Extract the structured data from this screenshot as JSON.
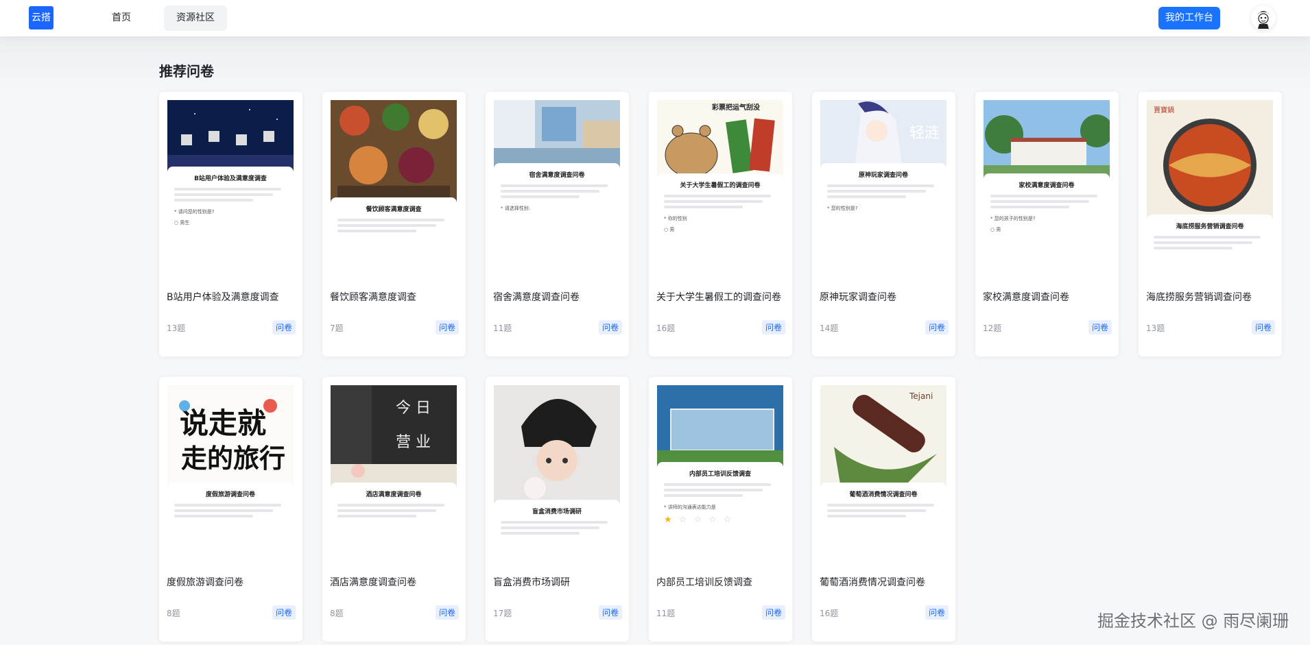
{
  "header": {
    "logo_text": "云搭",
    "nav": [
      {
        "label": "首页"
      },
      {
        "label": "资源社区"
      }
    ],
    "workbench_label": "我的工作台"
  },
  "section": {
    "title": "推荐问卷"
  },
  "cards": [
    {
      "title": "B站用户体验及满意度调查",
      "count": "13题",
      "tag": "问卷",
      "sheet_title": "B站用户体验及满意度调查",
      "question": "* 请问您的性别是?",
      "option": "男生"
    },
    {
      "title": "餐饮顾客满意度调查",
      "count": "7题",
      "tag": "问卷",
      "sheet_title": "餐饮顾客满意度调查",
      "question": "",
      "option": ""
    },
    {
      "title": "宿舍满意度调查问卷",
      "count": "11题",
      "tag": "问卷",
      "sheet_title": "宿舍满意度调查问卷",
      "question": "* 请选择性别:",
      "option": ""
    },
    {
      "title": "关于大学生暑假工的调查问卷",
      "count": "16题",
      "tag": "问卷",
      "sheet_title": "关于大学生暑假工的调查问卷",
      "question": "* 你的性别",
      "option": "男"
    },
    {
      "title": "原神玩家调查问卷",
      "count": "14题",
      "tag": "问卷",
      "sheet_title": "原神玩家调查问卷",
      "question": "* 您的性别是?",
      "option": ""
    },
    {
      "title": "家校满意度调查问卷",
      "count": "12题",
      "tag": "问卷",
      "sheet_title": "家校满意度调查问卷",
      "question": "* 您的孩子的性别是?",
      "option": "男"
    },
    {
      "title": "海底捞服务营销调查问卷",
      "count": "13题",
      "tag": "问卷",
      "sheet_title": "海底捞服务营销调查问卷",
      "question": "",
      "option": ""
    },
    {
      "title": "度假旅游调查问卷",
      "count": "8题",
      "tag": "问卷",
      "sheet_title": "度假旅游调查问卷",
      "question": "",
      "option": ""
    },
    {
      "title": "酒店满意度调查问卷",
      "count": "8题",
      "tag": "问卷",
      "sheet_title": "酒店满意度调查问卷",
      "question": "",
      "option": ""
    },
    {
      "title": "盲盒消费市场调研",
      "count": "17题",
      "tag": "问卷",
      "sheet_title": "盲盒消费市场调研",
      "question": "",
      "option": ""
    },
    {
      "title": "内部员工培训反馈调查",
      "count": "11题",
      "tag": "问卷",
      "sheet_title": "内部员工培训反馈调查",
      "question": "* 讲师的沟通表达能力是",
      "option": ""
    },
    {
      "title": "葡萄酒消费情况调查问卷",
      "count": "16题",
      "tag": "问卷",
      "sheet_title": "葡萄酒消费情况调查问卷",
      "question": "",
      "option": ""
    }
  ],
  "watermark": "掘金技术社区 @ 雨尽阑珊"
}
